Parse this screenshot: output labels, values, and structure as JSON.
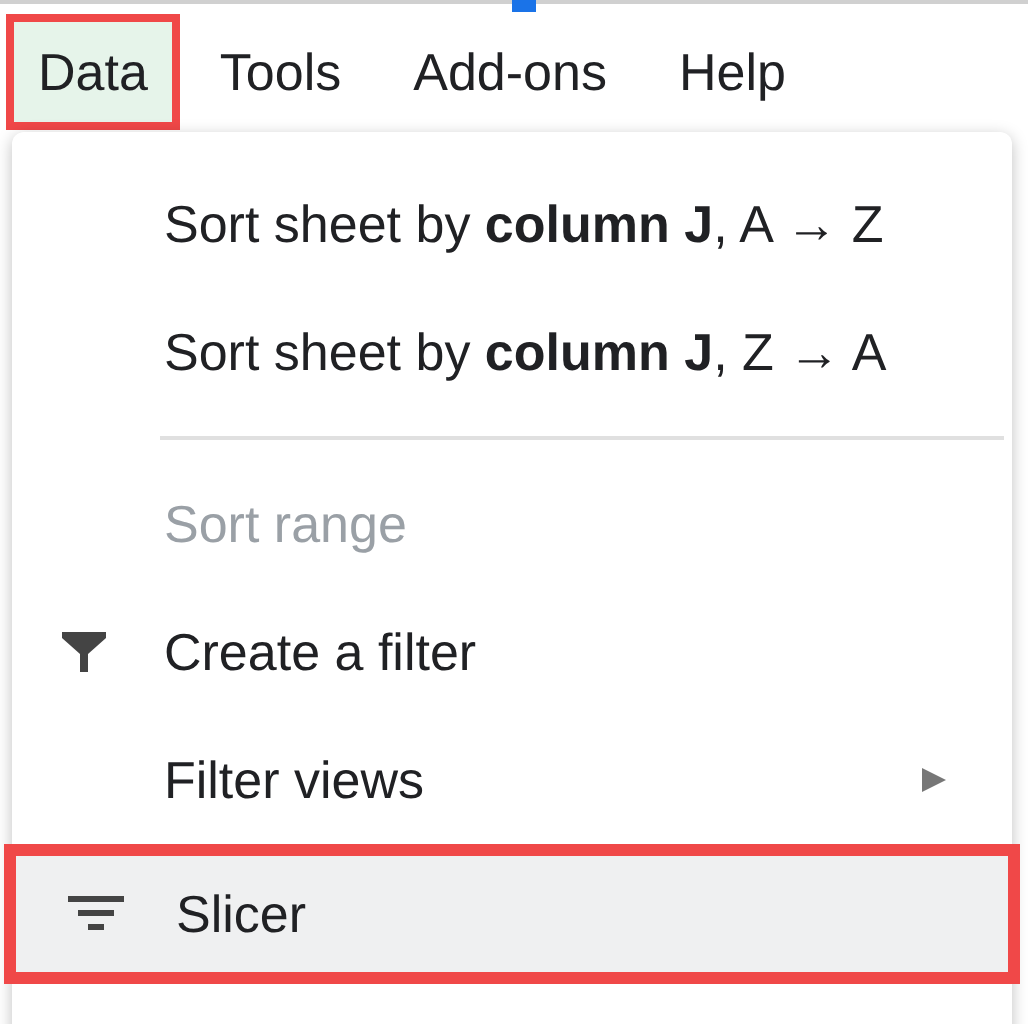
{
  "menubar": [
    {
      "label": "Data",
      "selected": true,
      "highlighted": true
    },
    {
      "label": "Tools",
      "selected": false,
      "highlighted": false
    },
    {
      "label": "Add-ons",
      "selected": false,
      "highlighted": false
    },
    {
      "label": "Help",
      "selected": false,
      "highlighted": false
    }
  ],
  "menu": {
    "items": [
      {
        "kind": "item",
        "label": "Sort sheet by **column J**, A → Z",
        "disabled": false,
        "selected": false,
        "highlighted": false
      },
      {
        "kind": "item",
        "label": "Sort sheet by **column J**, Z → A",
        "disabled": false,
        "selected": false,
        "highlighted": false
      },
      {
        "kind": "divider"
      },
      {
        "kind": "item",
        "label": "Sort range",
        "disabled": true,
        "selected": false,
        "highlighted": false
      },
      {
        "kind": "filter",
        "label": "Create a filter",
        "disabled": false,
        "selected": false,
        "highlighted": false
      },
      {
        "kind": "item",
        "label": "Filter views",
        "submenu": true,
        "disabled": false,
        "selected": false,
        "highlighted": false
      },
      {
        "kind": "slicer",
        "label": "Slicer",
        "disabled": false,
        "selected": true,
        "highlighted": true
      }
    ]
  }
}
